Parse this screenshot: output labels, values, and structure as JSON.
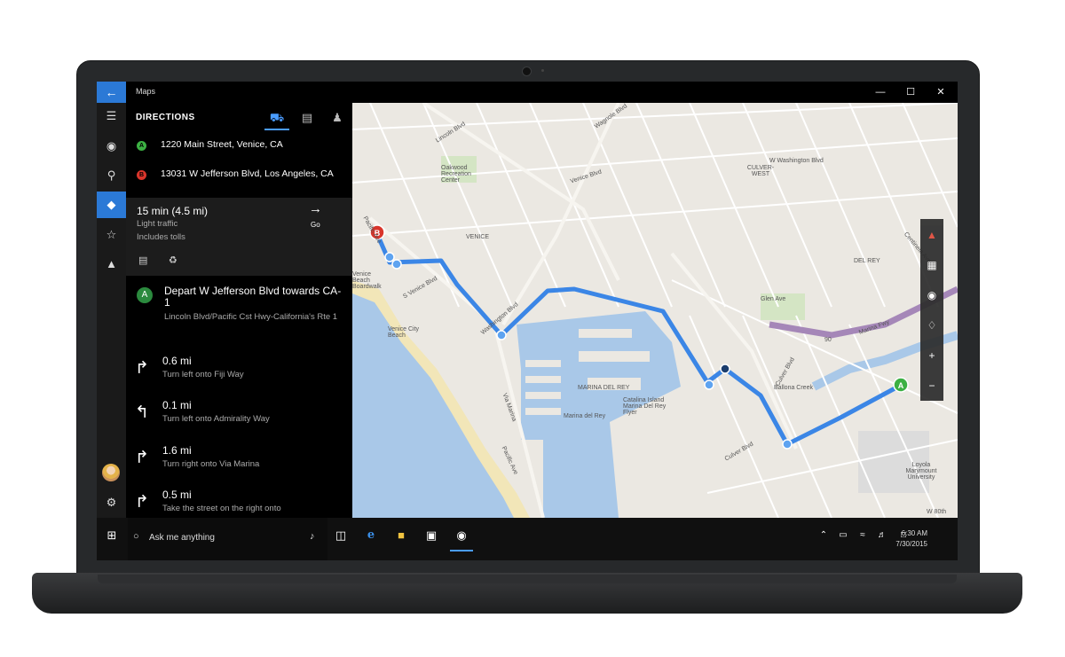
{
  "window": {
    "title": "Maps"
  },
  "panel": {
    "header": "DIRECTIONS",
    "waypoints": [
      {
        "badge": "A",
        "color": "#3cb043",
        "text": "1220 Main Street, Venice, CA"
      },
      {
        "badge": "B",
        "color": "#d9352b",
        "text": "13031 W Jefferson Blvd, Los Angeles, CA"
      }
    ],
    "route": {
      "time": "15 min (4.5 mi)",
      "traffic": "Light traffic",
      "tolls": "Includes tolls",
      "go_label": "Go"
    },
    "depart": {
      "badge": "A",
      "title": "Depart W Jefferson Blvd towards CA-1",
      "subtitle": "Lincoln Blvd/Pacific Cst Hwy-California's Rte 1"
    },
    "steps": [
      {
        "direction": "right",
        "distance": "0.6 mi",
        "instruction": "Turn left onto Fiji Way"
      },
      {
        "direction": "left",
        "distance": "0.1 mi",
        "instruction": "Turn left onto Admirality Way"
      },
      {
        "direction": "right",
        "distance": "1.6 mi",
        "instruction": "Turn right onto Via Marina"
      },
      {
        "direction": "right",
        "distance": "0.5 mi",
        "instruction": "Take the street on the right onto"
      }
    ]
  },
  "map": {
    "labels": [
      "Lincoln Blvd",
      "Wagnole Blvd",
      "Venice Blvd",
      "W Washington Blvd",
      "CULVER-WEST",
      "Oakwood Recreation Center",
      "VENICE",
      "Pacific Ave",
      "S Venice Blvd",
      "Venice Beach Boardwalk",
      "Venice City Beach",
      "Washington Blvd",
      "MARINA DEL REY",
      "Marina del Rey",
      "Catalina Island Marina Del Rey Flyer",
      "Via Marina",
      "Pacific Ave",
      "Culver Blvd",
      "Ballona Creek",
      "DEL REY",
      "Centinela Ave",
      "Marina Fwy",
      "90",
      "Glen Ave",
      "Culver Blvd",
      "Loyola Marymount University",
      "W 80th"
    ],
    "route_color": "#3b86e6"
  },
  "taskbar": {
    "search_placeholder": "Ask me anything",
    "time": "6:30 AM",
    "date": "7/30/2015"
  },
  "icons": {
    "back": "back-arrow-icon",
    "menu": "hamburger-menu-icon",
    "car": "car-icon",
    "bus": "bus-icon",
    "walk": "walk-icon"
  }
}
